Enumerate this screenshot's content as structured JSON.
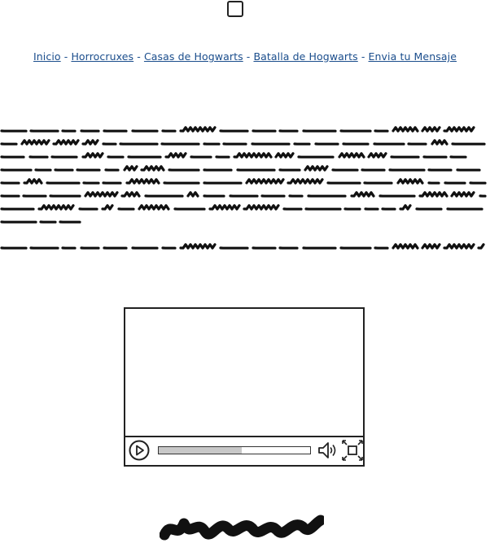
{
  "nav": {
    "links": [
      {
        "label": "Inicio"
      },
      {
        "label": "Horrocruxes"
      },
      {
        "label": "Casas de Hogwarts"
      },
      {
        "label": "Batalla de Hogwarts"
      },
      {
        "label": "Envia tu Mensaje"
      }
    ],
    "separator": " - "
  },
  "video": {
    "progress": 0.55
  },
  "colors": {
    "link": "#1a4d8c",
    "outline": "#222222",
    "progress_fill": "#c8c8c8"
  },
  "icons": [
    "checkbox-icon",
    "play-icon",
    "volume-icon",
    "fullscreen-icon"
  ]
}
